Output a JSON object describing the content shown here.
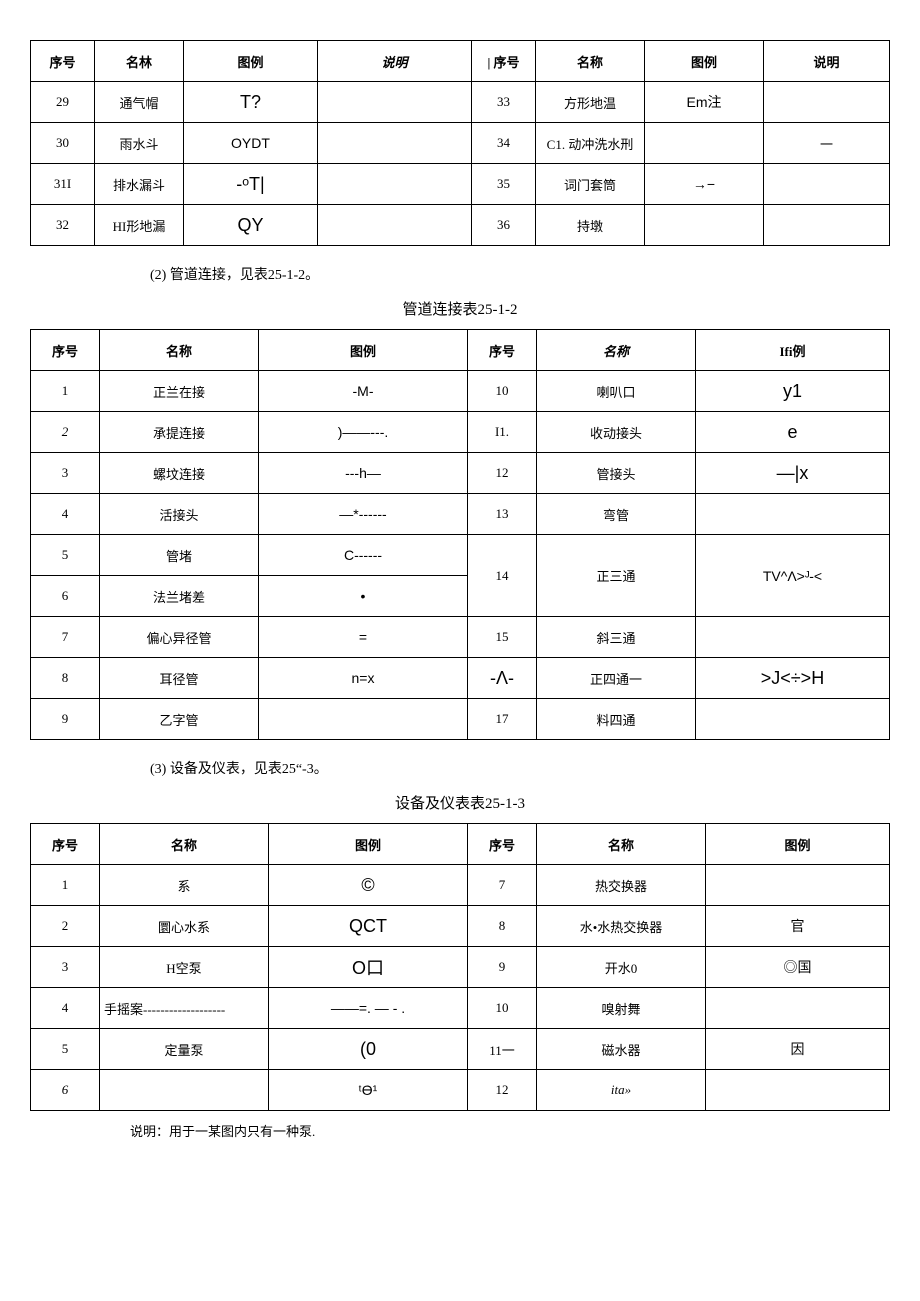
{
  "table1": {
    "headers_left": [
      "序号",
      "名林",
      "图例",
      "说明"
    ],
    "headers_right": [
      "序号",
      "名称",
      "图例",
      "说明"
    ],
    "rows_left": [
      {
        "no": "29",
        "name": "通气帽",
        "sym": "T?",
        "desc": ""
      },
      {
        "no": "30",
        "name": "雨水斗",
        "sym": "OYDT",
        "desc": ""
      },
      {
        "no": "31I",
        "name": "排水漏斗",
        "sym": "-ᵒT|",
        "desc": ""
      },
      {
        "no": "32",
        "name": "HI形地漏",
        "sym": "QY",
        "desc": ""
      }
    ],
    "rows_right": [
      {
        "no": "33",
        "name": "方形地温",
        "sym": "Em注",
        "desc": ""
      },
      {
        "no": "34",
        "name": "C1. 动冲洗水刑",
        "sym": "",
        "desc": "一"
      },
      {
        "no": "35",
        "name": "词门套筒",
        "sym": "→−",
        "desc": ""
      },
      {
        "no": "36",
        "name": "持墩",
        "sym": "",
        "desc": ""
      }
    ],
    "right_header_box": "| 序号"
  },
  "section2": {
    "note": "(2) 管道连接，见表25-1-2。",
    "caption": "管道连接表25-1-2"
  },
  "table2": {
    "headers_left": [
      "序号",
      "名称",
      "图例"
    ],
    "headers_right": [
      "序号",
      "名称",
      "Ifi例"
    ],
    "rows_left": [
      {
        "no": "1",
        "name": "正兰在接",
        "sym": "-M-"
      },
      {
        "no": "2",
        "name": "承提连接",
        "sym": ")——---."
      },
      {
        "no": "3",
        "name": "螺坟连接",
        "sym": "---h—"
      },
      {
        "no": "4",
        "name": "活接头",
        "sym": "—*------"
      },
      {
        "no": "5",
        "name": "管堵",
        "sym": "C------"
      },
      {
        "no": "6",
        "name": "法兰堵差",
        "sym": "•"
      },
      {
        "no": "7",
        "name": "偏心异径管",
        "sym": "="
      },
      {
        "no": "8",
        "name": "耳径管",
        "sym": "n=x"
      },
      {
        "no": "9",
        "name": "乙字管",
        "sym": ""
      }
    ],
    "rows_right": [
      {
        "no": "10",
        "name": "喇叭口",
        "sym": "y1"
      },
      {
        "no": "I1.",
        "name": "收动接头",
        "sym": "e"
      },
      {
        "no": "12",
        "name": "管接头",
        "sym": "—|x"
      },
      {
        "no": "13",
        "name": "弯管",
        "sym": ""
      },
      {
        "no": "14",
        "name": "正三通",
        "sym": "TV^Λ>ᴶ-<"
      },
      {
        "no": "15",
        "name": "斜三通",
        "sym": ""
      },
      {
        "no": "-Λ-",
        "name": "正四通一",
        "sym": ">J<÷>H"
      },
      {
        "no": "17",
        "name": "料四通",
        "sym": ""
      }
    ]
  },
  "section3": {
    "note": "(3) 设备及仪表，见表25“-3。",
    "caption": "设备及仪表表25-1-3"
  },
  "table3": {
    "headers_left": [
      "序号",
      "名称",
      "图例"
    ],
    "headers_right": [
      "序号",
      "名称",
      "图例"
    ],
    "rows_left": [
      {
        "no": "1",
        "name": "系",
        "sym": "©"
      },
      {
        "no": "2",
        "name": "圜心水系",
        "sym": "QCT"
      },
      {
        "no": "3",
        "name": "H空泵",
        "sym": "O口"
      },
      {
        "no": "4",
        "name": "手摇案-------------------",
        "sym": "——=. — - ."
      },
      {
        "no": "5",
        "name": "定量泵",
        "sym": "(0"
      },
      {
        "no": "6",
        "name": "",
        "sym": "ᵗƟ¹"
      }
    ],
    "rows_right": [
      {
        "no": "7",
        "name": "热交换器",
        "sym": ""
      },
      {
        "no": "8",
        "name": "水•水热交换器",
        "sym": "官"
      },
      {
        "no": "9",
        "name": "开水0",
        "sym": "◎国"
      },
      {
        "no": "10",
        "name": "嗅射舞",
        "sym": ""
      },
      {
        "no": "11一",
        "name": "磁水器",
        "sym": "因"
      },
      {
        "no": "12",
        "name": "ita»",
        "sym": ""
      }
    ]
  },
  "footnote": "说明：用于一某图内只有一种泵."
}
